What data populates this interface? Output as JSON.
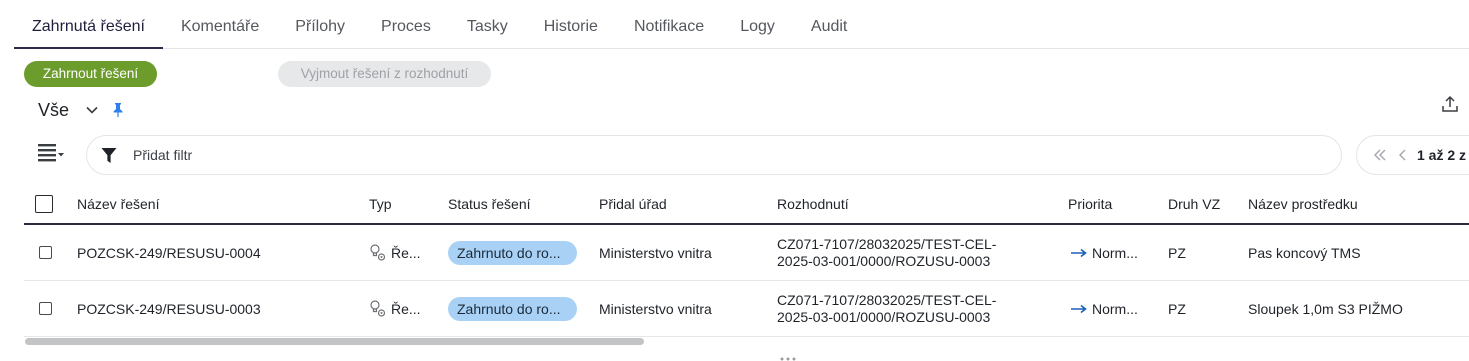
{
  "tabs": [
    "Zahrnutá řešení",
    "Komentáře",
    "Přílohy",
    "Proces",
    "Tasky",
    "Historie",
    "Notifikace",
    "Logy",
    "Audit"
  ],
  "actions": {
    "include_label": "Zahrnout řešení",
    "exclude_label": "Vyjmout řešení z rozhodnutí"
  },
  "view": {
    "label": "Vše"
  },
  "filter": {
    "placeholder": "Přidat filtr"
  },
  "pager": {
    "text": "1 až 2 z"
  },
  "table": {
    "headers": {
      "name": "Název řešení",
      "type": "Typ",
      "status": "Status řešení",
      "office": "Přidal úřad",
      "decision": "Rozhodnutí",
      "priority": "Priorita",
      "kind": "Druh VZ",
      "device": "Název prostředku"
    },
    "rows": [
      {
        "name": "POZCSK-249/RESUSU-0004",
        "type": "Ře...",
        "status": "Zahrnuto do ro...",
        "office": "Ministerstvo vnitra",
        "decision": "CZ071-7107/28032025/TEST-CEL-2025-03-001/0000/ROZUSU-0003",
        "priority": "Norm...",
        "kind": "PZ",
        "device": "Pas koncový TMS"
      },
      {
        "name": "POZCSK-249/RESUSU-0003",
        "type": "Ře...",
        "status": "Zahrnuto do ro...",
        "office": "Ministerstvo vnitra",
        "decision": "CZ071-7107/28032025/TEST-CEL-2025-03-001/0000/ROZUSU-0003",
        "priority": "Norm...",
        "kind": "PZ",
        "device": "Sloupek 1,0m S3 PIŽMO"
      }
    ]
  },
  "colors": {
    "include_button": "#6b9c2c",
    "status_badge": "#a9d1f5",
    "priority_arrow": "#1e5fb8",
    "pin": "#2f80ed"
  },
  "icons": {
    "view_chevron": "chevron-down-icon",
    "pin": "pin-icon",
    "export": "upload-icon",
    "columns": "column-settings-icon",
    "filter": "funnel-icon",
    "pager_first": "double-chevron-left-icon",
    "pager_prev": "chevron-left-icon",
    "type": "bulb-gear-icon",
    "priority": "arrow-right-icon"
  }
}
